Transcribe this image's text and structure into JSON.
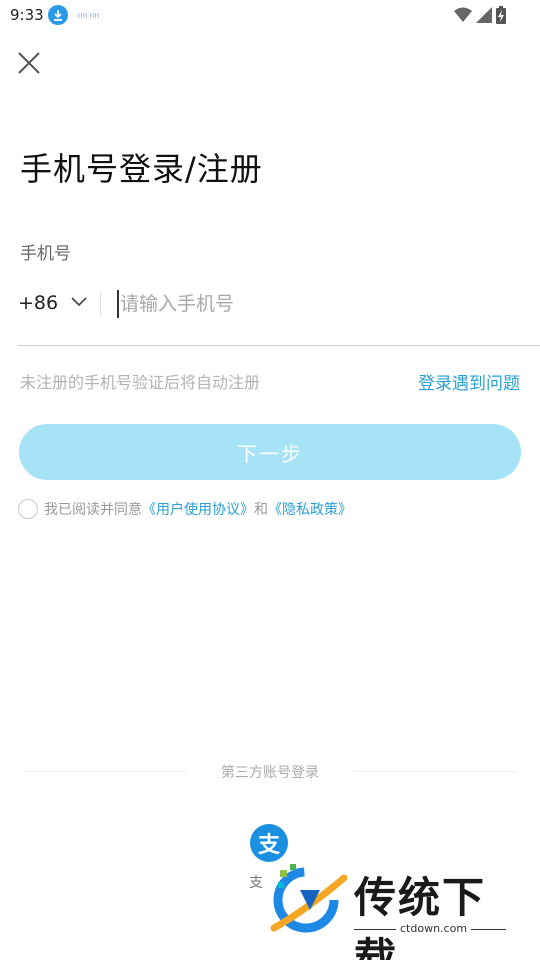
{
  "status_bar": {
    "time": "9:33",
    "mini_text": "(((( (((("
  },
  "page": {
    "title": "手机号登录/注册",
    "phone_label": "手机号",
    "country_code": "+86",
    "phone_placeholder": "请输入手机号",
    "phone_value": "",
    "hint": "未注册的手机号验证后将自动注册",
    "problem_link": "登录遇到问题",
    "next_button": "下一步"
  },
  "agreement": {
    "prefix": "我已阅读并同意",
    "user_agreement": "《用户使用协议》",
    "and": "和",
    "privacy_policy": "《隐私政策》",
    "checked": false
  },
  "third_party": {
    "title": "第三方账号登录",
    "alipay_label": "支",
    "alipay_icon_char": "支"
  },
  "watermark": {
    "brand": "传统下载",
    "domain": "ctdown.com"
  },
  "colors": {
    "accent": "#2a9fd6",
    "button_disabled": "#a6e3f6",
    "alipay": "#1b8fe0"
  },
  "icons": {
    "close": "close-icon",
    "chevron": "chevron-down-icon",
    "wifi": "wifi-icon",
    "signal": "signal-icon",
    "battery": "battery-icon",
    "download": "download-icon"
  }
}
